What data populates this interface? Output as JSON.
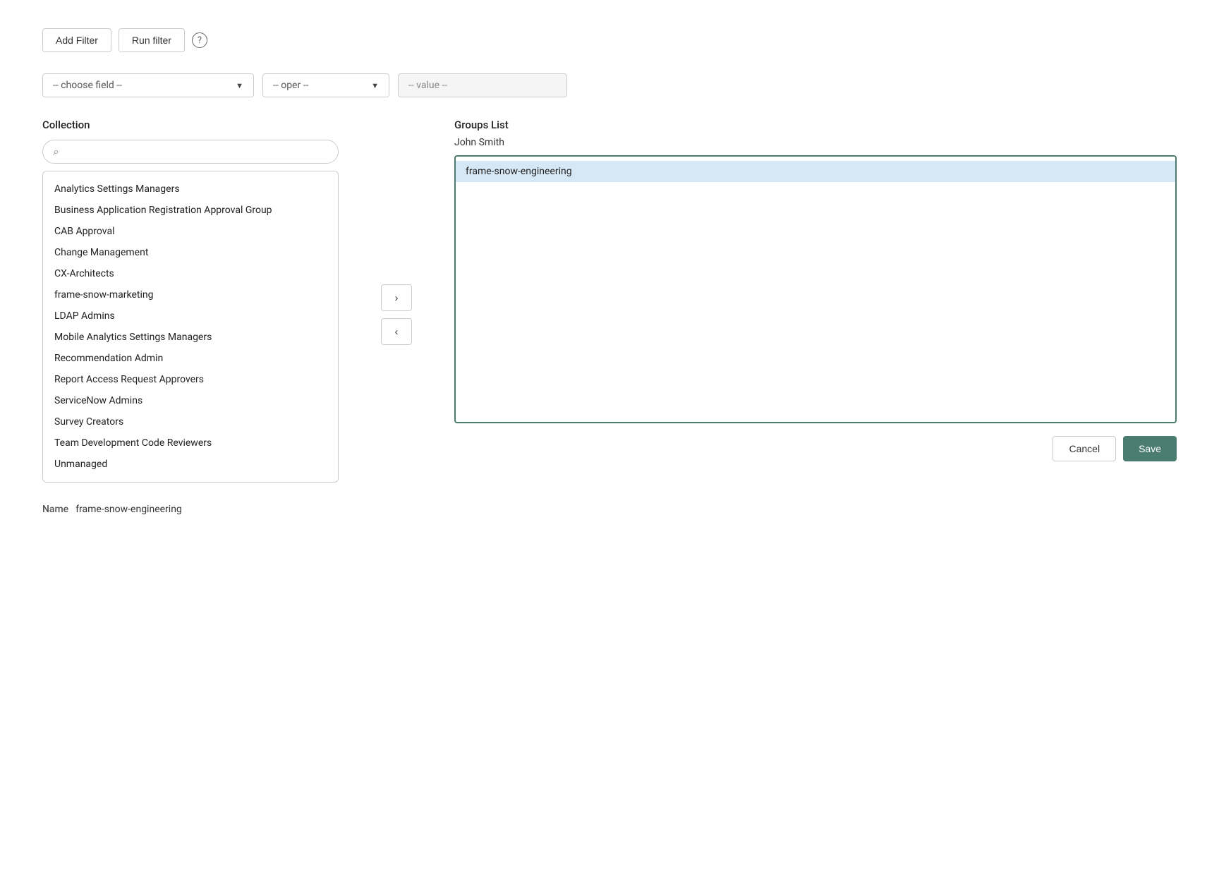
{
  "toolbar": {
    "add_filter_label": "Add Filter",
    "run_filter_label": "Run filter",
    "help_icon_label": "?"
  },
  "filter": {
    "field_placeholder": "-- choose field --",
    "oper_placeholder": "-- oper --",
    "value_placeholder": "-- value --"
  },
  "collection": {
    "label": "Collection",
    "search_placeholder": "",
    "items": [
      {
        "id": 1,
        "label": "Analytics Settings Managers"
      },
      {
        "id": 2,
        "label": "Business Application Registration Approval Group"
      },
      {
        "id": 3,
        "label": "CAB Approval"
      },
      {
        "id": 4,
        "label": "Change Management"
      },
      {
        "id": 5,
        "label": "CX-Architects"
      },
      {
        "id": 6,
        "label": "frame-snow-marketing"
      },
      {
        "id": 7,
        "label": "LDAP Admins"
      },
      {
        "id": 8,
        "label": "Mobile Analytics Settings Managers"
      },
      {
        "id": 9,
        "label": "Recommendation Admin"
      },
      {
        "id": 10,
        "label": "Report Access Request Approvers"
      },
      {
        "id": 11,
        "label": "ServiceNow Admins"
      },
      {
        "id": 12,
        "label": "Survey Creators"
      },
      {
        "id": 13,
        "label": "Team Development Code Reviewers"
      },
      {
        "id": 14,
        "label": "Unmanaged"
      }
    ]
  },
  "transfer": {
    "move_right_label": "›",
    "move_left_label": "‹"
  },
  "groups": {
    "label": "Groups List",
    "user_name": "John Smith",
    "items": [
      {
        "id": 1,
        "label": "frame-snow-engineering",
        "selected": true
      }
    ]
  },
  "actions": {
    "cancel_label": "Cancel",
    "save_label": "Save"
  },
  "name_row": {
    "label": "Name",
    "value": "frame-snow-engineering"
  }
}
